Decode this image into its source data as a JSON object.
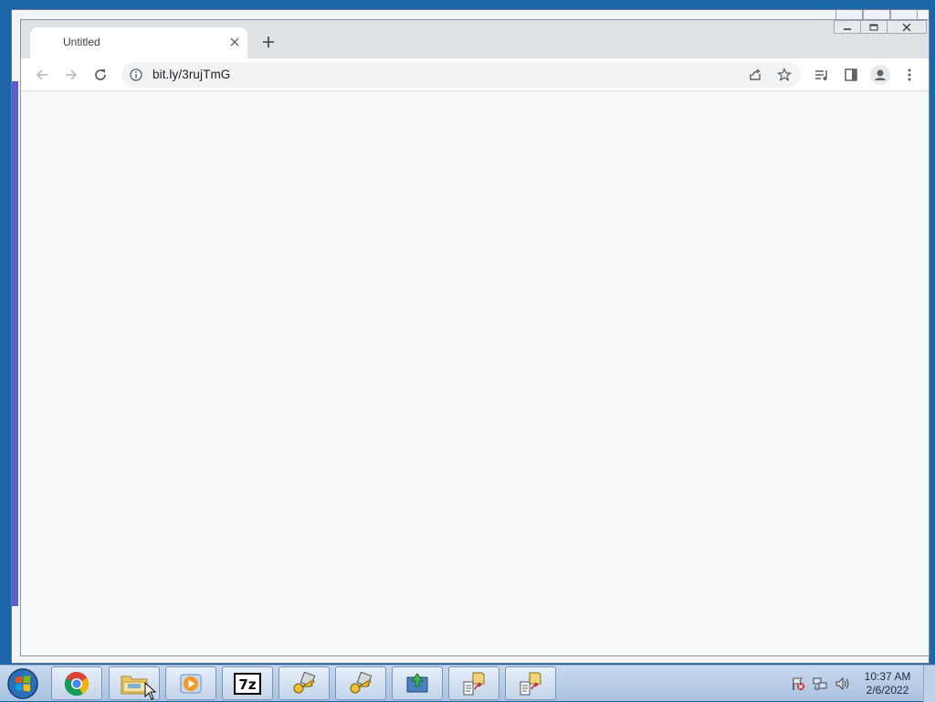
{
  "browser": {
    "tab": {
      "title": "Untitled",
      "close_icon": "close-icon"
    },
    "new_tab_icon": "plus-icon",
    "toolbar": {
      "back_icon": "arrow-left-icon",
      "forward_icon": "arrow-right-icon",
      "reload_icon": "reload-icon",
      "address": "bit.ly/3rujTmG",
      "share_icon": "share-icon",
      "bookmark_icon": "star-icon",
      "reading_list_icon": "reading-list-icon",
      "side_panel_icon": "side-panel-icon",
      "profile_icon": "profile-icon",
      "menu_icon": "kebab-menu-icon"
    }
  },
  "taskbar": {
    "apps": [
      {
        "name": "Google Chrome",
        "icon": "chrome-icon"
      },
      {
        "name": "Windows Explorer",
        "icon": "folder-icon"
      },
      {
        "name": "Media Player",
        "icon": "media-player-icon"
      },
      {
        "name": "7-Zip",
        "icon": "7zip-icon",
        "label": "7z"
      },
      {
        "name": "Key tool",
        "icon": "key-icon"
      },
      {
        "name": "Key tool",
        "icon": "key-icon"
      },
      {
        "name": "Download tool",
        "icon": "download-icon"
      },
      {
        "name": "File transfer",
        "icon": "file-transfer-icon"
      },
      {
        "name": "File transfer",
        "icon": "file-transfer-icon"
      }
    ],
    "clock": {
      "time": "10:37 AM",
      "date": "2/6/2022"
    }
  }
}
